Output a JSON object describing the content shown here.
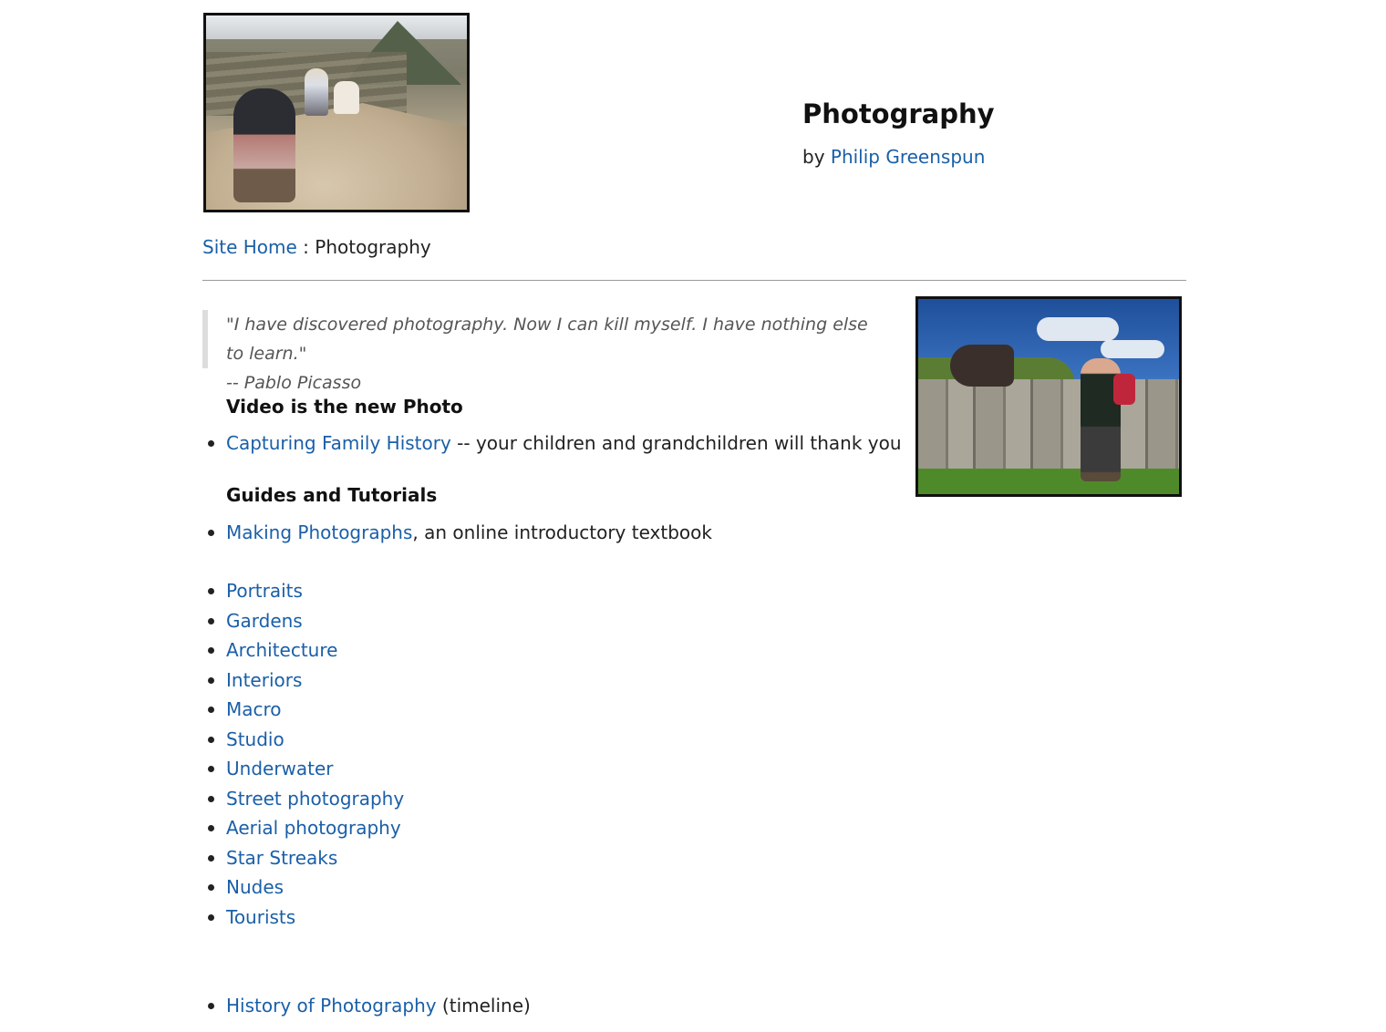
{
  "header": {
    "title": "Photography",
    "byline_prefix": "by",
    "author": "Philip Greenspun"
  },
  "breadcrumb": {
    "home": "Site Home",
    "separator": " : ",
    "current": "Photography"
  },
  "quote": {
    "text": "\"I have discovered photography. Now I can kill myself. I have nothing else to learn.\"",
    "attribution": "-- Pablo Picasso"
  },
  "video_section": {
    "heading": "Video is the new Photo",
    "link": "Capturing Family History",
    "suffix": " -- your children and grandchildren will thank you"
  },
  "guides_section": {
    "heading": "Guides and Tutorials",
    "link": "Making Photographs",
    "suffix": ", an online introductory textbook"
  },
  "topics": [
    "Portraits",
    "Gardens",
    "Architecture",
    "Interiors",
    "Macro",
    "Studio",
    "Underwater",
    "Street photography",
    "Aerial photography",
    "Star Streaks",
    "Nudes",
    "Tourists"
  ],
  "history": {
    "link": "History of Photography",
    "suffix": " (timeline)"
  },
  "colors": {
    "link": "#1a5fa8",
    "text": "#222222",
    "rule": "#9a9a9a"
  }
}
